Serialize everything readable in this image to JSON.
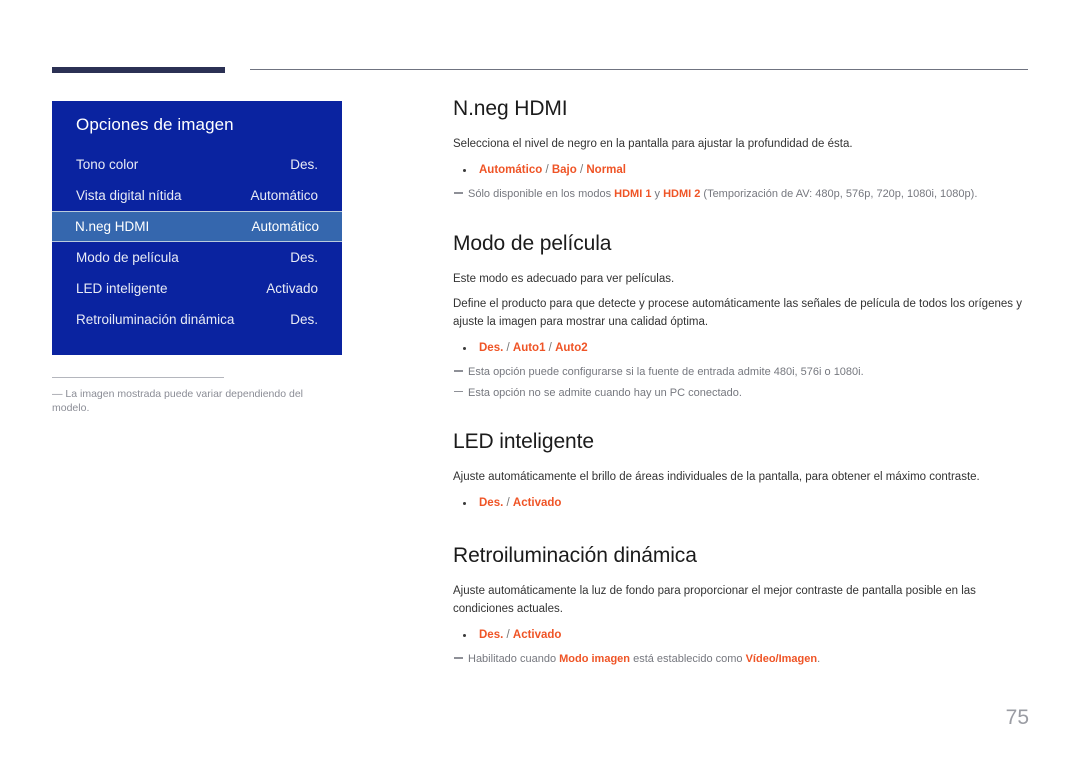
{
  "page": {
    "number": "75"
  },
  "osd": {
    "title": "Opciones de imagen",
    "rows": [
      {
        "label": "Tono color",
        "value": "Des.",
        "selected": false
      },
      {
        "label": "Vista digital nítida",
        "value": "Automático",
        "selected": false
      },
      {
        "label": "N.neg HDMI",
        "value": "Automático",
        "selected": true
      },
      {
        "label": "Modo de película",
        "value": "Des.",
        "selected": false
      },
      {
        "label": "LED inteligente",
        "value": "Activado",
        "selected": false
      },
      {
        "label": "Retroiluminación dinámica",
        "value": "Des.",
        "selected": false
      }
    ]
  },
  "left_note": {
    "marker": "―",
    "text": "La imagen mostrada puede variar dependiendo del modelo."
  },
  "sections": {
    "hdmi_black_level": {
      "heading": "N.neg HDMI",
      "paragraph": "Selecciona el nivel de negro en la pantalla para ajustar la profundidad de ésta.",
      "options": [
        {
          "label": "Automático"
        },
        {
          "label": "Bajo"
        },
        {
          "label": "Normal"
        }
      ],
      "note_prefix": "Sólo disponible en los modos ",
      "note_hl1": "HDMI 1",
      "note_mid": " y ",
      "note_hl2": "HDMI 2",
      "note_suffix": " (Temporización de AV: 480p, 576p, 720p, 1080i, 1080p)."
    },
    "film_mode": {
      "heading": "Modo de película",
      "paragraph1": "Este modo es adecuado para ver películas.",
      "paragraph2": "Define el producto para que detecte y procese automáticamente las señales de película de todos los orígenes y ajuste la imagen para mostrar una calidad óptima.",
      "options": [
        {
          "label": "Des."
        },
        {
          "label": "Auto1"
        },
        {
          "label": "Auto2"
        }
      ],
      "note1": "Esta opción puede configurarse si la fuente de entrada admite 480i, 576i o 1080i.",
      "note2": "Esta opción no se admite cuando hay un PC conectado."
    },
    "smart_led": {
      "heading": "LED inteligente",
      "paragraph": "Ajuste automáticamente el brillo de áreas individuales de la pantalla, para obtener el máximo contraste.",
      "options": [
        {
          "label": "Des."
        },
        {
          "label": "Activado"
        }
      ]
    },
    "dynamic_backlight": {
      "heading": "Retroiluminación dinámica",
      "paragraph": "Ajuste automáticamente la luz de fondo para proporcionar el mejor contraste de pantalla posible en las condiciones actuales.",
      "options": [
        {
          "label": "Des."
        },
        {
          "label": "Activado"
        }
      ],
      "note_prefix": "Habilitado cuando ",
      "note_hl1": "Modo imagen",
      "note_mid": " está establecido como ",
      "note_hl2": "Vídeo/Imagen",
      "note_suffix": "."
    }
  },
  "separator": "/",
  "colors": {
    "osd_background": "#0a23a0",
    "osd_selected": "#3567ae",
    "accent_orange": "#ef5426",
    "rule_navy": "#2b3154"
  }
}
